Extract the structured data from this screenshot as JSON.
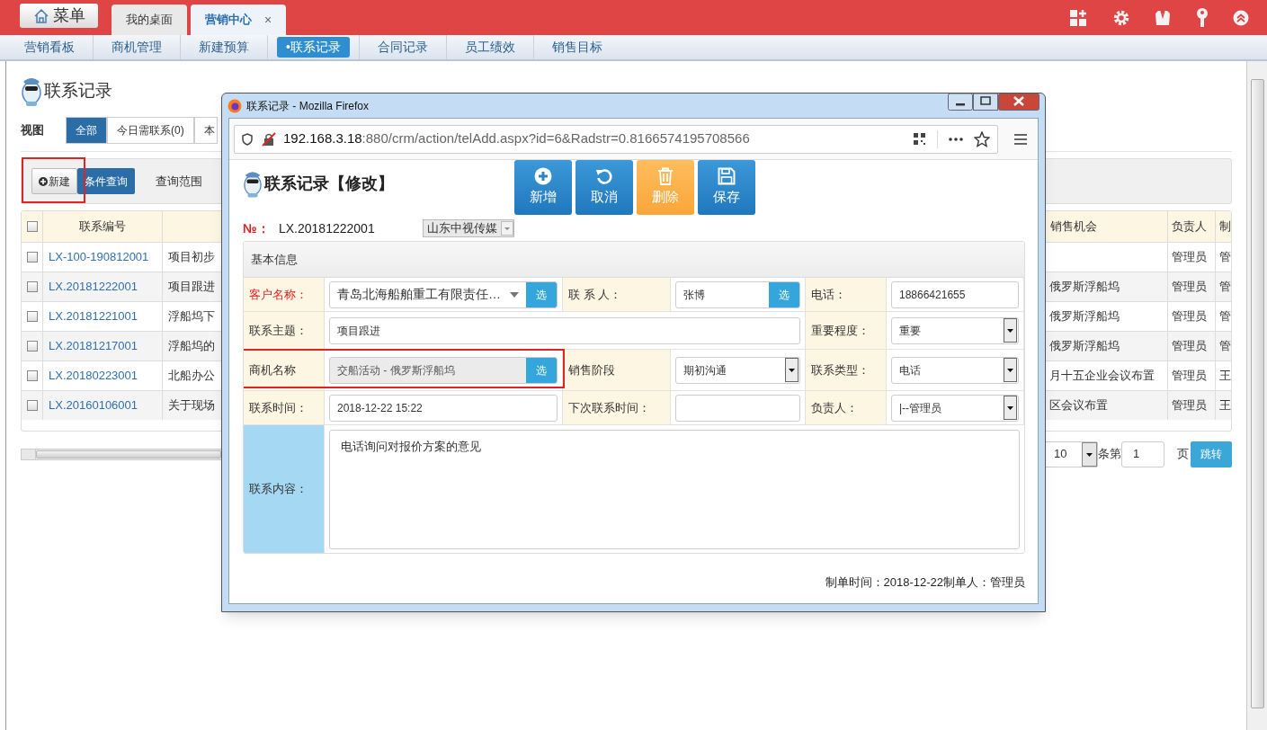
{
  "top_bar": {
    "menu_button": "菜单",
    "tabs": [
      {
        "label": "我的桌面",
        "selected": false
      },
      {
        "label": "营销中心",
        "selected": true,
        "close": "×"
      }
    ]
  },
  "nav": [
    {
      "label": "营销看板",
      "selected": false
    },
    {
      "label": "商机管理",
      "selected": false
    },
    {
      "label": "新建预算",
      "selected": false
    },
    {
      "label": "•联系记录",
      "selected": true
    },
    {
      "label": "合同记录",
      "selected": false
    },
    {
      "label": "员工绩效",
      "selected": false
    },
    {
      "label": "销售目标",
      "selected": false
    }
  ],
  "page": {
    "title": "联系记录",
    "view_label": "视图",
    "views": [
      {
        "label": "全部",
        "selected": true
      },
      {
        "label": "今日需联系(0)",
        "selected": false
      },
      {
        "label": "本",
        "selected": false
      }
    ],
    "toolbar": [
      {
        "kind": "new",
        "label": "新建",
        "highlighted": true
      },
      {
        "kind": "query",
        "label": "条件查询",
        "highlighted": false
      },
      {
        "kind": "plain",
        "label": "查询范围",
        "highlighted": false
      }
    ],
    "table": {
      "all_checked": false,
      "columns": [
        "联系编号",
        "销售机会",
        "负责人",
        "制"
      ],
      "rows": [
        {
          "checked": false,
          "number": "LX-100-190812001",
          "subject": "项目初步",
          "owner": "管理员",
          "creator": "管"
        },
        {
          "checked": false,
          "number": "LX.20181222001",
          "subject": "项目跟进",
          "opportunity": "俄罗斯浮船坞",
          "owner": "管理员",
          "creator": "管"
        },
        {
          "checked": false,
          "number": "LX.20181221001",
          "subject": "浮船坞下",
          "opportunity": "俄罗斯浮船坞",
          "owner": "管理员",
          "creator": "管"
        },
        {
          "checked": false,
          "number": "LX.20181217001",
          "subject": "浮船坞的",
          "opportunity": "俄罗斯浮船坞",
          "owner": "管理员",
          "creator": "管"
        },
        {
          "checked": false,
          "number": "LX.20180223001",
          "subject": "北船办公",
          "opportunity": "月十五企业会议布置",
          "owner": "管理员",
          "creator": "王"
        },
        {
          "checked": false,
          "number": "LX.20160106001",
          "subject": "关于现场",
          "opportunity": "区会议布置",
          "owner": "管理员",
          "creator": "王"
        }
      ]
    },
    "pagination": {
      "page_size": "10",
      "middle": "条第",
      "page": "1",
      "suffix": "页",
      "go": "跳转"
    }
  },
  "popup": {
    "title": "联系记录 - Mozilla Firefox",
    "url_host": "192.168.3.18",
    "url_rest": ":880/crm/action/telAdd.aspx?id=6&Radstr=0.8166574195708566",
    "heading": "联系记录【修改】",
    "actions": [
      {
        "kind": "add",
        "label": "新增"
      },
      {
        "kind": "undo",
        "label": "取消"
      },
      {
        "kind": "delete",
        "label": "删除"
      },
      {
        "kind": "save",
        "label": "保存"
      }
    ],
    "number_label": "№：",
    "number": "LX.20181222001",
    "company": "山东中视传媒",
    "section": "基本信息",
    "fields": [
      {
        "label": "客户名称：",
        "required": true,
        "highlighted": false,
        "kind": "combo",
        "value": "青岛北海船舶重工有限责任…",
        "disabled": false,
        "pick": "选"
      },
      {
        "label": "联 系 人：",
        "required": false,
        "highlighted": false,
        "kind": "input",
        "value": "张博",
        "disabled": false,
        "pick": "选"
      },
      {
        "label": "电话：",
        "required": false,
        "highlighted": false,
        "kind": "input",
        "value": "18866421655",
        "disabled": false
      },
      {
        "label": "联系主题：",
        "required": false,
        "highlighted": false,
        "kind": "wide_input",
        "value": "项目跟进",
        "disabled": false
      },
      {
        "label": "重要程度：",
        "required": false,
        "highlighted": false,
        "kind": "select",
        "value": "重要",
        "disabled": false
      },
      {
        "label": "商机名称",
        "required": false,
        "highlighted": true,
        "kind": "input",
        "value": "交船活动 - 俄罗斯浮船坞",
        "disabled": true,
        "pick": "选"
      },
      {
        "label": "销售阶段",
        "required": false,
        "highlighted": false,
        "kind": "select",
        "value": "期初沟通",
        "disabled": false
      },
      {
        "label": "联系类型：",
        "required": false,
        "highlighted": false,
        "kind": "select",
        "value": "电话",
        "disabled": false
      },
      {
        "label": "联系时间：",
        "required": false,
        "highlighted": false,
        "kind": "input",
        "value": "2018-12-22 15:22",
        "disabled": false
      },
      {
        "label": "下次联系时间：",
        "required": false,
        "highlighted": false,
        "kind": "input",
        "disabled": false
      },
      {
        "label": "负责人：",
        "required": false,
        "highlighted": false,
        "kind": "select",
        "value": "|--管理员",
        "disabled": false
      }
    ],
    "content_label": "联系内容：",
    "content": "电话询问对报价方案的意见",
    "footer": "制单时间：2018-12-22制单人：管理员"
  }
}
